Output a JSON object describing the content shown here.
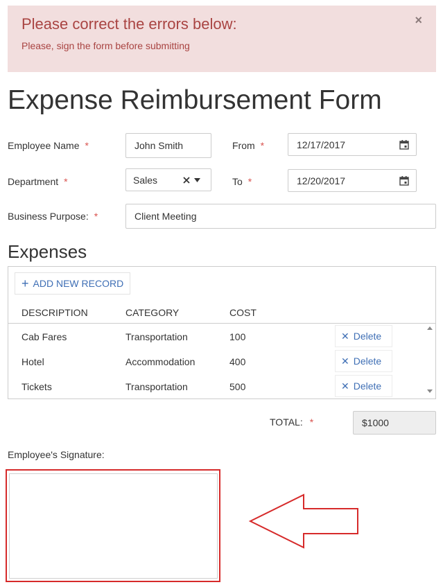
{
  "alert": {
    "title": "Please correct the errors below:",
    "message": "Please, sign the form before submitting",
    "close_glyph": "×"
  },
  "page_title": "Expense Reimbursement Form",
  "form": {
    "employee_name_label": "Employee Name",
    "employee_name_value": "John Smith",
    "from_label": "From",
    "from_value": "12/17/2017",
    "department_label": "Department",
    "department_value": "Sales",
    "to_label": "To",
    "to_value": "12/20/2017",
    "business_purpose_label": "Business Purpose:",
    "business_purpose_value": "Client Meeting",
    "required_mark": "*"
  },
  "expenses": {
    "title": "Expenses",
    "add_label": "ADD NEW RECORD",
    "add_glyph": "+",
    "columns": [
      "DESCRIPTION",
      "CATEGORY",
      "COST"
    ],
    "delete_label": "Delete",
    "delete_glyph": "✕",
    "rows": [
      {
        "description": "Cab Fares",
        "category": "Transportation",
        "cost": "100"
      },
      {
        "description": "Hotel",
        "category": "Accommodation",
        "cost": "400"
      },
      {
        "description": "Tickets",
        "category": "Transportation",
        "cost": "500"
      }
    ]
  },
  "total": {
    "label": "TOTAL:",
    "value": "$1000"
  },
  "signature": {
    "label": "Employee's Signature:"
  },
  "colors": {
    "alert_bg": "#f2dede",
    "alert_text": "#a94442",
    "link": "#3f6fb5",
    "required": "#d9534f",
    "highlight": "#d62a2a"
  },
  "icons": {
    "calendar": "calendar-icon",
    "clear": "clear-x-icon",
    "dropdown": "caret-down-icon",
    "close": "close-icon",
    "plus": "plus-icon",
    "delete": "delete-x-icon",
    "annotation": "left-arrow-annotation"
  }
}
